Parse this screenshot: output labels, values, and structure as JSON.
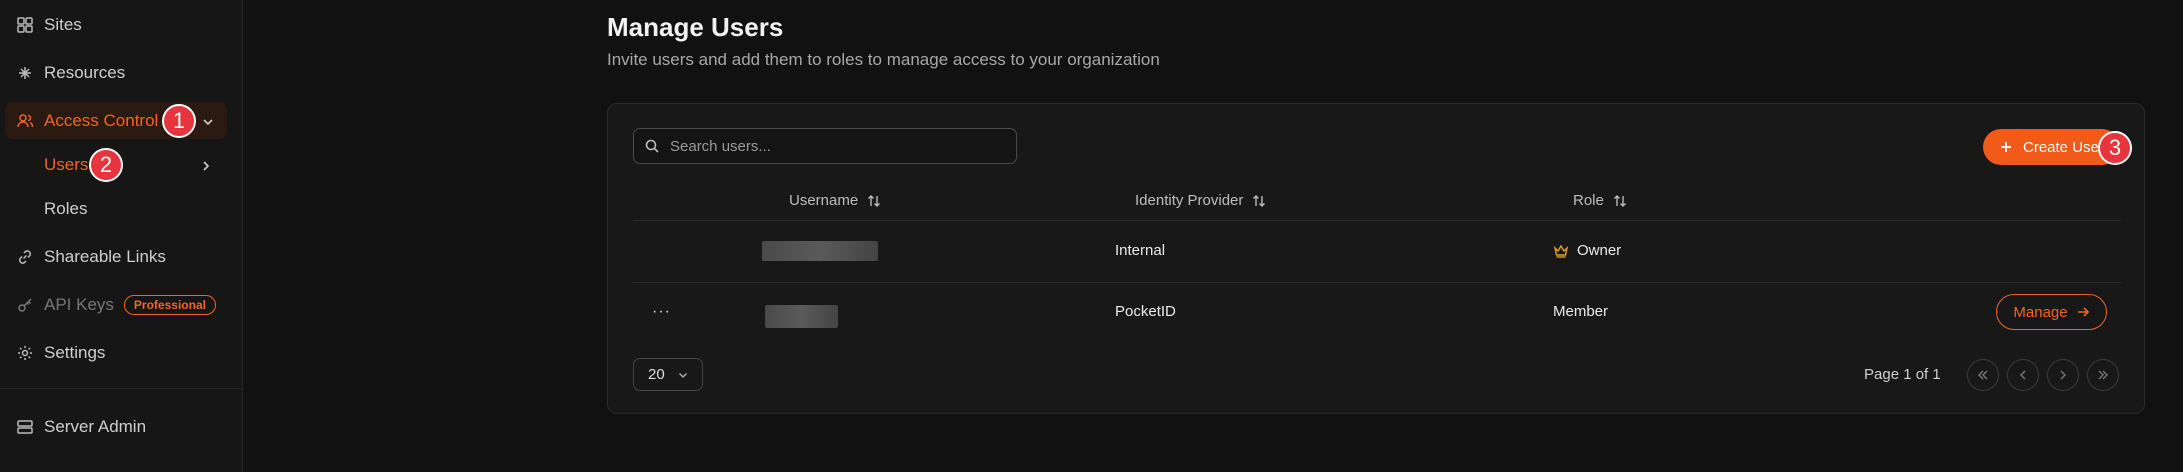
{
  "sidebar": {
    "items": [
      {
        "label": "Sites",
        "icon": "sites-icon"
      },
      {
        "label": "Resources",
        "icon": "resources-icon"
      },
      {
        "label": "Access Control",
        "icon": "users-icon"
      },
      {
        "label": "Users"
      },
      {
        "label": "Roles"
      },
      {
        "label": "Shareable Links",
        "icon": "link-icon"
      },
      {
        "label": "API Keys",
        "icon": "key-icon",
        "badge": "Professional"
      },
      {
        "label": "Settings",
        "icon": "gear-icon"
      },
      {
        "label": "Server Admin",
        "icon": "server-icon"
      }
    ]
  },
  "steps": [
    "1",
    "2",
    "3"
  ],
  "header": {
    "title": "Manage Users",
    "subtitle": "Invite users and add them to roles to manage access to your organization"
  },
  "search": {
    "placeholder": "Search users..."
  },
  "create_button": "Create User",
  "table": {
    "columns": [
      "Username",
      "Identity Provider",
      "Role"
    ],
    "rows": [
      {
        "provider": "Internal",
        "role": "Owner"
      },
      {
        "provider": "PocketID",
        "role": "Member",
        "action": "Manage",
        "menu": "···"
      }
    ]
  },
  "pagination": {
    "page_size": "20",
    "page_info": "Page 1 of 1"
  },
  "colors": {
    "accent": "#f26522",
    "step_badge": "#e8343c",
    "background": "#111111"
  }
}
